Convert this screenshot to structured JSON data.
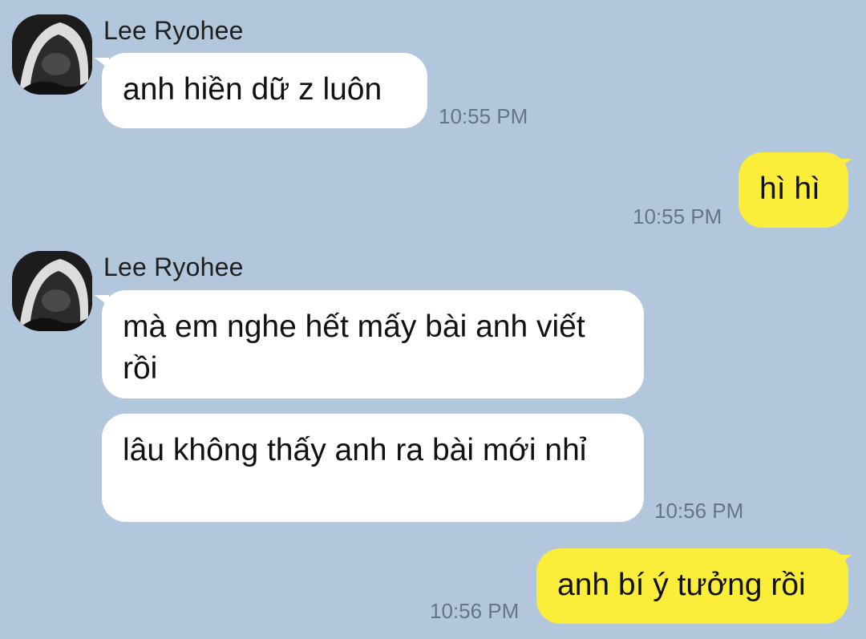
{
  "messages": [
    {
      "sender": "Lee Ryohee",
      "text": "anh hiền dữ z luôn",
      "time": "10:55 PM"
    },
    {
      "text": "hì hì",
      "time": "10:55 PM"
    },
    {
      "sender": "Lee Ryohee",
      "text": "mà em nghe hết mấy bài anh viết rồi"
    },
    {
      "text": "lâu không thấy anh ra bài mới nhỉ",
      "time": "10:56 PM"
    },
    {
      "text": "anh bí ý tưởng rồi",
      "time": "10:56 PM"
    }
  ],
  "colors": {
    "background": "#b3c7dc",
    "incoming_bubble": "#ffffff",
    "outgoing_bubble": "#fbee3a",
    "timestamp": "#667585"
  }
}
